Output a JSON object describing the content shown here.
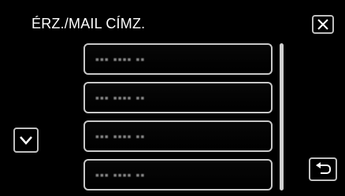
{
  "screen": {
    "title": "ÉRZ./MAIL CÍMZ."
  },
  "icons": {
    "close": "close-icon",
    "scroll_down": "chevron-down-icon",
    "back": "return-arrow-icon"
  },
  "list": {
    "items": [
      {
        "text": "▪▪▪ ▪▪▪▪ ▪▪"
      },
      {
        "text": "▪▪▪ ▪▪▪▪ ▪▪"
      },
      {
        "text": "▪▪▪ ▪▪▪▪ ▪▪"
      },
      {
        "text": "▪▪▪ ▪▪▪▪ ▪▪"
      }
    ]
  }
}
